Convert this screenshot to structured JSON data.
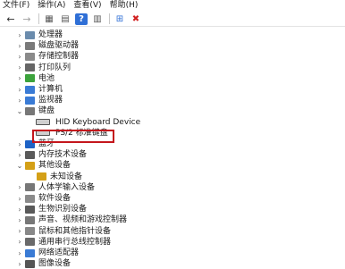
{
  "menu": [
    "文件(F)",
    "操作(A)",
    "查看(V)",
    "帮助(H)"
  ],
  "toolbar": {
    "back": "←",
    "forward": "→",
    "grid": "▦",
    "props": "▤",
    "help": "?",
    "list": "▥",
    "scan": "⊞",
    "disable": "✖"
  },
  "devices": [
    {
      "label": "处理器",
      "icon": "cpu-icon",
      "color": "#6b8cad",
      "state": "collapsed"
    },
    {
      "label": "磁盘驱动器",
      "icon": "disk-icon",
      "color": "#7a7a7a",
      "state": "collapsed"
    },
    {
      "label": "存储控制器",
      "icon": "storage-icon",
      "color": "#8a8a8a",
      "state": "collapsed"
    },
    {
      "label": "打印队列",
      "icon": "printer-icon",
      "color": "#666666",
      "state": "collapsed"
    },
    {
      "label": "电池",
      "icon": "battery-icon",
      "color": "#3ca33c",
      "state": "collapsed"
    },
    {
      "label": "计算机",
      "icon": "computer-icon",
      "color": "#3a7bd5",
      "state": "collapsed"
    },
    {
      "label": "监视器",
      "icon": "monitor-icon",
      "color": "#3a7bd5",
      "state": "collapsed"
    },
    {
      "label": "键盘",
      "icon": "keyboard-icon",
      "color": "#777777",
      "state": "expanded",
      "children": [
        "HID Keyboard Device",
        "PS/2 标准键盘"
      ]
    },
    {
      "label": "蓝牙",
      "icon": "bluetooth-icon",
      "color": "#1f63c6",
      "state": "collapsed"
    },
    {
      "label": "内存技术设备",
      "icon": "memory-icon",
      "color": "#5a5a5a",
      "state": "collapsed"
    },
    {
      "label": "其他设备",
      "icon": "other-device-icon",
      "color": "#d4a017",
      "state": "expanded",
      "children": [
        "未知设备"
      ]
    },
    {
      "label": "人体学输入设备",
      "icon": "hid-icon",
      "color": "#777777",
      "state": "collapsed"
    },
    {
      "label": "软件设备",
      "icon": "software-icon",
      "color": "#8a8a8a",
      "state": "collapsed"
    },
    {
      "label": "生物识别设备",
      "icon": "biometric-icon",
      "color": "#5a5a5a",
      "state": "collapsed"
    },
    {
      "label": "声音、视频和游戏控制器",
      "icon": "sound-icon",
      "color": "#777777",
      "state": "collapsed"
    },
    {
      "label": "鼠标和其他指针设备",
      "icon": "mouse-icon",
      "color": "#888888",
      "state": "collapsed"
    },
    {
      "label": "通用串行总线控制器",
      "icon": "usb-icon",
      "color": "#6a6a6a",
      "state": "collapsed"
    },
    {
      "label": "网络适配器",
      "icon": "network-icon",
      "color": "#3a7bd5",
      "state": "collapsed"
    },
    {
      "label": "图像设备",
      "icon": "imaging-icon",
      "color": "#555555",
      "state": "collapsed"
    }
  ]
}
